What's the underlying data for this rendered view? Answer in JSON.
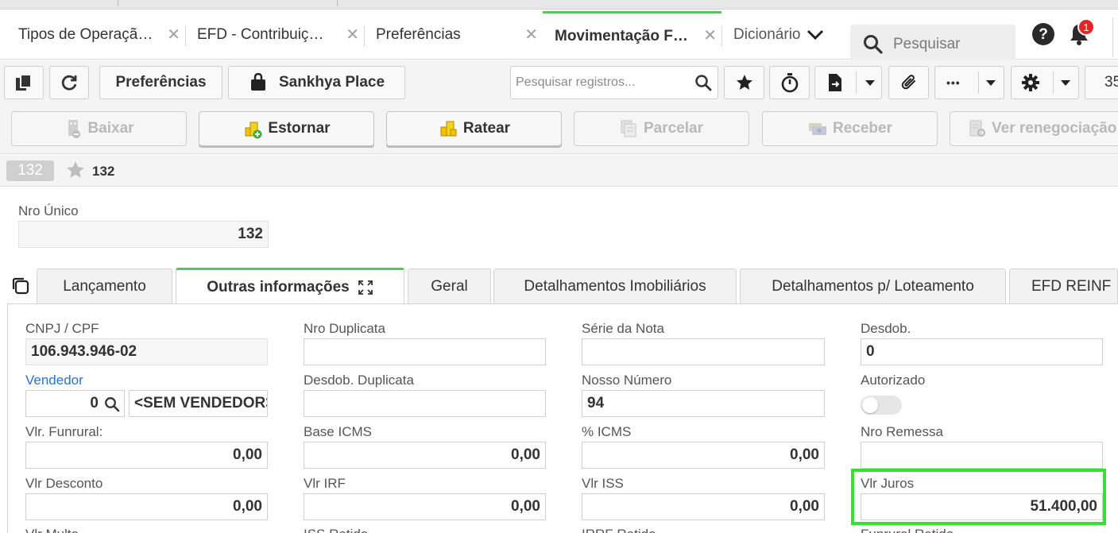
{
  "tabs": [
    {
      "label": "Tipos de Operaçã…",
      "close": "✕"
    },
    {
      "label": "EFD - Contribuiç…",
      "close": "✕"
    },
    {
      "label": "Preferências",
      "close": "✕"
    },
    {
      "label": "Movimentação F…",
      "close": "✕",
      "active": true
    },
    {
      "label": "Dicionário"
    }
  ],
  "header": {
    "search_placeholder": "Pesquisar",
    "notification_count": "1"
  },
  "toolbar": {
    "preferencias_label": "Preferências",
    "sankhya_label": "Sankhya Place",
    "search_placeholder": "Pesquisar registros...",
    "more_label": "•••",
    "page_size": "35"
  },
  "actions": [
    {
      "label": "Baixar",
      "enabled": false
    },
    {
      "label": "Estornar",
      "enabled": true
    },
    {
      "label": "Ratear",
      "enabled": true
    },
    {
      "label": "Parcelar",
      "enabled": false
    },
    {
      "label": "Receber",
      "enabled": false
    },
    {
      "label": "Ver renegociação",
      "enabled": false
    }
  ],
  "record": {
    "badge": "132",
    "number": "132"
  },
  "nro_unico": {
    "label": "Nro Único",
    "value": "132"
  },
  "inner_tabs": [
    {
      "label": "Lançamento"
    },
    {
      "label": "Outras informações",
      "active": true
    },
    {
      "label": "Geral"
    },
    {
      "label": "Detalhamentos Imobiliários"
    },
    {
      "label": "Detalhamentos p/ Loteamento"
    },
    {
      "label": "EFD REINF"
    }
  ],
  "form": {
    "cnpj": {
      "label": "CNPJ / CPF",
      "value": "106.943.946-02"
    },
    "vendedor": {
      "label": "Vendedor",
      "code": "0",
      "name": "<SEM VENDEDOR>"
    },
    "vlr_funrural": {
      "label": "Vlr. Funrural:",
      "value": "0,00"
    },
    "vlr_desconto": {
      "label": "Vlr Desconto",
      "value": "0,00"
    },
    "nro_duplicata": {
      "label": "Nro Duplicata",
      "value": ""
    },
    "desdob_duplicata": {
      "label": "Desdob. Duplicata",
      "value": ""
    },
    "base_icms": {
      "label": "Base ICMS",
      "value": "0,00"
    },
    "vlr_irf": {
      "label": "Vlr IRF",
      "value": "0,00"
    },
    "serie_nota": {
      "label": "Série da Nota",
      "value": ""
    },
    "nosso_numero": {
      "label": "Nosso Número",
      "value": "94"
    },
    "pct_icms": {
      "label": "% ICMS",
      "value": "0,00"
    },
    "vlr_iss": {
      "label": "Vlr ISS",
      "value": "0,00"
    },
    "desdob": {
      "label": "Desdob.",
      "value": "0"
    },
    "autorizado": {
      "label": "Autorizado",
      "value": false
    },
    "nro_remessa": {
      "label": "Nro Remessa",
      "value": ""
    },
    "vlr_juros": {
      "label": "Vlr Juros",
      "value": "51.400,00"
    },
    "vlr_multa": {
      "label": "Vlr Multa"
    },
    "iss_retido": {
      "label": "ISS Retido"
    },
    "irrf_retido": {
      "label": "IRRF Retido"
    },
    "funrural_retido": {
      "label": "Funrural Retido"
    }
  },
  "colors": {
    "accent_green": "#5cc45c",
    "highlight": "#35e035",
    "link": "#2b73c9",
    "badge": "#e8242b"
  }
}
